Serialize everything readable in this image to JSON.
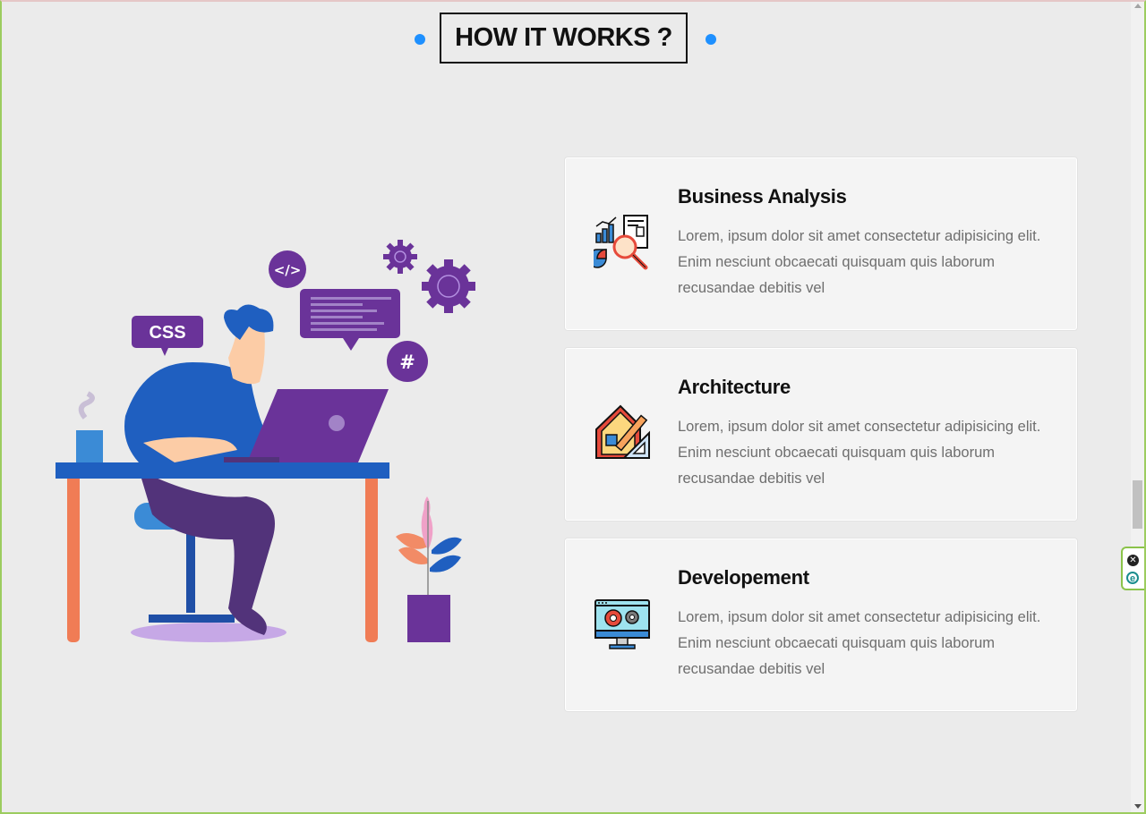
{
  "section": {
    "heading": "HOW IT WORKS ?"
  },
  "illustration": {
    "css_label": "CSS",
    "code_label": "</>",
    "hash_label": "#"
  },
  "cards": [
    {
      "title": "Business Analysis",
      "description": "Lorem, ipsum dolor sit amet consectetur adipisicing elit. Enim nesciunt obcaecati quisquam quis laborum recusandae debitis vel",
      "icon": "business-analysis-icon"
    },
    {
      "title": "Architecture",
      "description": "Lorem, ipsum dolor sit amet consectetur adipisicing elit. Enim nesciunt obcaecati quisquam quis laborum recusandae debitis vel",
      "icon": "architecture-icon"
    },
    {
      "title": "Developement",
      "description": "Lorem, ipsum dolor sit amet consectetur adipisicing elit. Enim nesciunt obcaecati quisquam quis laborum recusandae debitis vel",
      "icon": "development-icon"
    }
  ],
  "side_widget": {
    "close_symbol": "✕",
    "e_symbol": "e"
  },
  "colors": {
    "accent_dot": "#1e90ff",
    "purple": "#6a3399",
    "blue": "#1f5fc0"
  }
}
